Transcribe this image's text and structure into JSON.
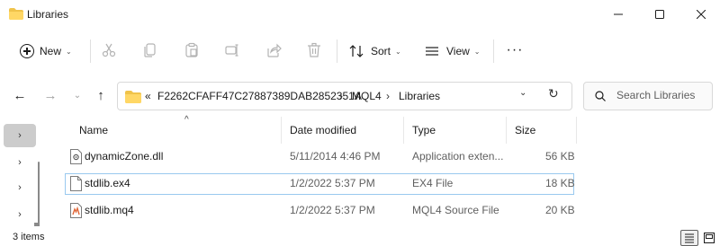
{
  "window": {
    "title": "Libraries",
    "minimize_icon": "minimize-icon",
    "maximize_icon": "maximize-icon",
    "close_icon": "close-icon"
  },
  "command_bar": {
    "new_label": "New",
    "sort_label": "Sort",
    "view_label": "View",
    "more_label": "···",
    "icons": [
      "cut-icon",
      "copy-icon",
      "paste-icon",
      "rename-icon",
      "share-icon",
      "delete-icon"
    ]
  },
  "address": {
    "crumbs": [
      "«",
      "F2262CFAFF47C27887389DAB2852351A",
      "MQL4",
      "Libraries"
    ],
    "separator": "›"
  },
  "search": {
    "placeholder": "Search Libraries"
  },
  "columns": {
    "name": "Name",
    "date": "Date modified",
    "type": "Type",
    "size": "Size"
  },
  "files": [
    {
      "name": "dynamicZone.dll",
      "date": "5/11/2014 4:46 PM",
      "type": "Application exten...",
      "size": "56 KB",
      "icon": "dll-file-icon"
    },
    {
      "name": "stdlib.ex4",
      "date": "1/2/2022 5:37 PM",
      "type": "EX4 File",
      "size": "18 KB",
      "icon": "generic-file-icon"
    },
    {
      "name": "stdlib.mq4",
      "date": "1/2/2022 5:37 PM",
      "type": "MQL4 Source File",
      "size": "20 KB",
      "icon": "mq4-file-icon"
    }
  ],
  "status": {
    "item_count": "3 items"
  },
  "colors": {
    "accent": "#0067c0",
    "folder": "#f0c34a",
    "selection_border": "#99c9ef"
  }
}
